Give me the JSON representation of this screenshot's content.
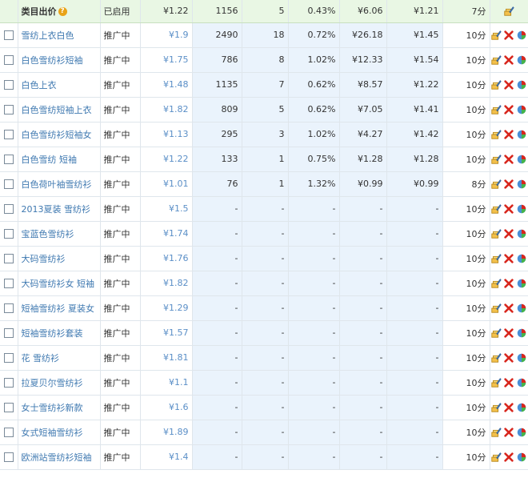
{
  "header": {
    "category_bid_label": "类目出价",
    "help_icon": "?",
    "status": "已启用",
    "bid": "¥1.22",
    "impressions": "1156",
    "clicks": "5",
    "ctr": "0.43%",
    "cost": "¥6.06",
    "avg_cpc": "¥1.21",
    "quality": "7分"
  },
  "rows": [
    {
      "keyword": "雪纺上衣白色",
      "status": "推广中",
      "bid": "¥1.9",
      "impressions": "2490",
      "clicks": "18",
      "ctr": "0.72%",
      "cost": "¥26.18",
      "avg_cpc": "¥1.45",
      "quality": "10分"
    },
    {
      "keyword": "白色雪纺衫短袖",
      "status": "推广中",
      "bid": "¥1.75",
      "impressions": "786",
      "clicks": "8",
      "ctr": "1.02%",
      "cost": "¥12.33",
      "avg_cpc": "¥1.54",
      "quality": "10分"
    },
    {
      "keyword": "白色上衣",
      "status": "推广中",
      "bid": "¥1.48",
      "impressions": "1135",
      "clicks": "7",
      "ctr": "0.62%",
      "cost": "¥8.57",
      "avg_cpc": "¥1.22",
      "quality": "10分"
    },
    {
      "keyword": "白色雪纺短袖上衣",
      "status": "推广中",
      "bid": "¥1.82",
      "impressions": "809",
      "clicks": "5",
      "ctr": "0.62%",
      "cost": "¥7.05",
      "avg_cpc": "¥1.41",
      "quality": "10分"
    },
    {
      "keyword": "白色雪纺衫短袖女",
      "status": "推广中",
      "bid": "¥1.13",
      "impressions": "295",
      "clicks": "3",
      "ctr": "1.02%",
      "cost": "¥4.27",
      "avg_cpc": "¥1.42",
      "quality": "10分"
    },
    {
      "keyword": "白色雪纺 短袖",
      "status": "推广中",
      "bid": "¥1.22",
      "impressions": "133",
      "clicks": "1",
      "ctr": "0.75%",
      "cost": "¥1.28",
      "avg_cpc": "¥1.28",
      "quality": "10分"
    },
    {
      "keyword": "白色荷叶袖雪纺衫",
      "status": "推广中",
      "bid": "¥1.01",
      "impressions": "76",
      "clicks": "1",
      "ctr": "1.32%",
      "cost": "¥0.99",
      "avg_cpc": "¥0.99",
      "quality": "8分"
    },
    {
      "keyword": "2013夏装 雪纺衫",
      "status": "推广中",
      "bid": "¥1.5",
      "impressions": "-",
      "clicks": "-",
      "ctr": "-",
      "cost": "-",
      "avg_cpc": "-",
      "quality": "10分"
    },
    {
      "keyword": "宝蓝色雪纺衫",
      "status": "推广中",
      "bid": "¥1.74",
      "impressions": "-",
      "clicks": "-",
      "ctr": "-",
      "cost": "-",
      "avg_cpc": "-",
      "quality": "10分"
    },
    {
      "keyword": "大码雪纺衫",
      "status": "推广中",
      "bid": "¥1.76",
      "impressions": "-",
      "clicks": "-",
      "ctr": "-",
      "cost": "-",
      "avg_cpc": "-",
      "quality": "10分"
    },
    {
      "keyword": "大码雪纺衫女 短袖",
      "status": "推广中",
      "bid": "¥1.82",
      "impressions": "-",
      "clicks": "-",
      "ctr": "-",
      "cost": "-",
      "avg_cpc": "-",
      "quality": "10分"
    },
    {
      "keyword": "短袖雪纺衫 夏装女",
      "status": "推广中",
      "bid": "¥1.29",
      "impressions": "-",
      "clicks": "-",
      "ctr": "-",
      "cost": "-",
      "avg_cpc": "-",
      "quality": "10分"
    },
    {
      "keyword": "短袖雪纺衫套装",
      "status": "推广中",
      "bid": "¥1.57",
      "impressions": "-",
      "clicks": "-",
      "ctr": "-",
      "cost": "-",
      "avg_cpc": "-",
      "quality": "10分"
    },
    {
      "keyword": "花 雪纺衫",
      "status": "推广中",
      "bid": "¥1.81",
      "impressions": "-",
      "clicks": "-",
      "ctr": "-",
      "cost": "-",
      "avg_cpc": "-",
      "quality": "10分"
    },
    {
      "keyword": "拉夏贝尔雪纺衫",
      "status": "推广中",
      "bid": "¥1.1",
      "impressions": "-",
      "clicks": "-",
      "ctr": "-",
      "cost": "-",
      "avg_cpc": "-",
      "quality": "10分"
    },
    {
      "keyword": "女士雪纺衫新款",
      "status": "推广中",
      "bid": "¥1.6",
      "impressions": "-",
      "clicks": "-",
      "ctr": "-",
      "cost": "-",
      "avg_cpc": "-",
      "quality": "10分"
    },
    {
      "keyword": "女式短袖雪纺衫",
      "status": "推广中",
      "bid": "¥1.89",
      "impressions": "-",
      "clicks": "-",
      "ctr": "-",
      "cost": "-",
      "avg_cpc": "-",
      "quality": "10分"
    },
    {
      "keyword": "欧洲站雪纺衫短袖",
      "status": "推广中",
      "bid": "¥1.4",
      "impressions": "-",
      "clicks": "-",
      "ctr": "-",
      "cost": "-",
      "avg_cpc": "-",
      "quality": "10分"
    }
  ],
  "icons": {
    "edit": "edit-bid-icon",
    "delete": "delete-icon",
    "report": "report-chart-icon"
  }
}
